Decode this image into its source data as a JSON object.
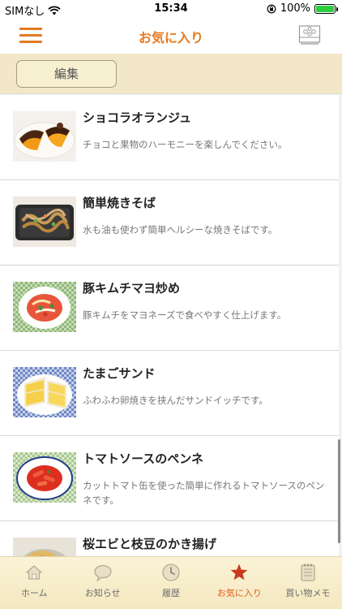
{
  "status": {
    "carrier": "SIMなし",
    "time": "15:34",
    "battery": "100%",
    "battery_level": 1.0
  },
  "header": {
    "title": "お気に入り",
    "menu_icon": "hamburger-menu-icon",
    "right_icon": "kitchen-stove-icon"
  },
  "toolbar": {
    "edit_label": "編集"
  },
  "recipes": [
    {
      "title": "ショコラオランジュ",
      "description": "チョコと果物のハーモニーを楽しんでください。"
    },
    {
      "title": "簡単焼きそば",
      "description": "水も油も使わず簡単ヘルシーな焼きそばです。"
    },
    {
      "title": "豚キムチマヨ炒め",
      "description": "豚キムチをマヨネーズで食べやすく仕上げます。"
    },
    {
      "title": "たまごサンド",
      "description": "ふわふわ卵焼きを挟んだサンドイッチです。"
    },
    {
      "title": "トマトソースのペンネ",
      "description": "カットトマト缶を使った簡単に作れるトマトソースのペンネです。"
    },
    {
      "title": "桜エビと枝豆のかき揚げ",
      "description": ""
    }
  ],
  "tabs": [
    {
      "label": "ホーム",
      "icon": "home-icon"
    },
    {
      "label": "お知らせ",
      "icon": "chat-bubble-icon"
    },
    {
      "label": "履歴",
      "icon": "clock-icon"
    },
    {
      "label": "お気に入り",
      "icon": "star-icon",
      "active": true
    },
    {
      "label": "買い物メモ",
      "icon": "notepad-icon"
    }
  ],
  "colors": {
    "accent": "#e47a20",
    "active_tab": "#e05a1b",
    "toolbar_bg": "#f2e8c7"
  }
}
